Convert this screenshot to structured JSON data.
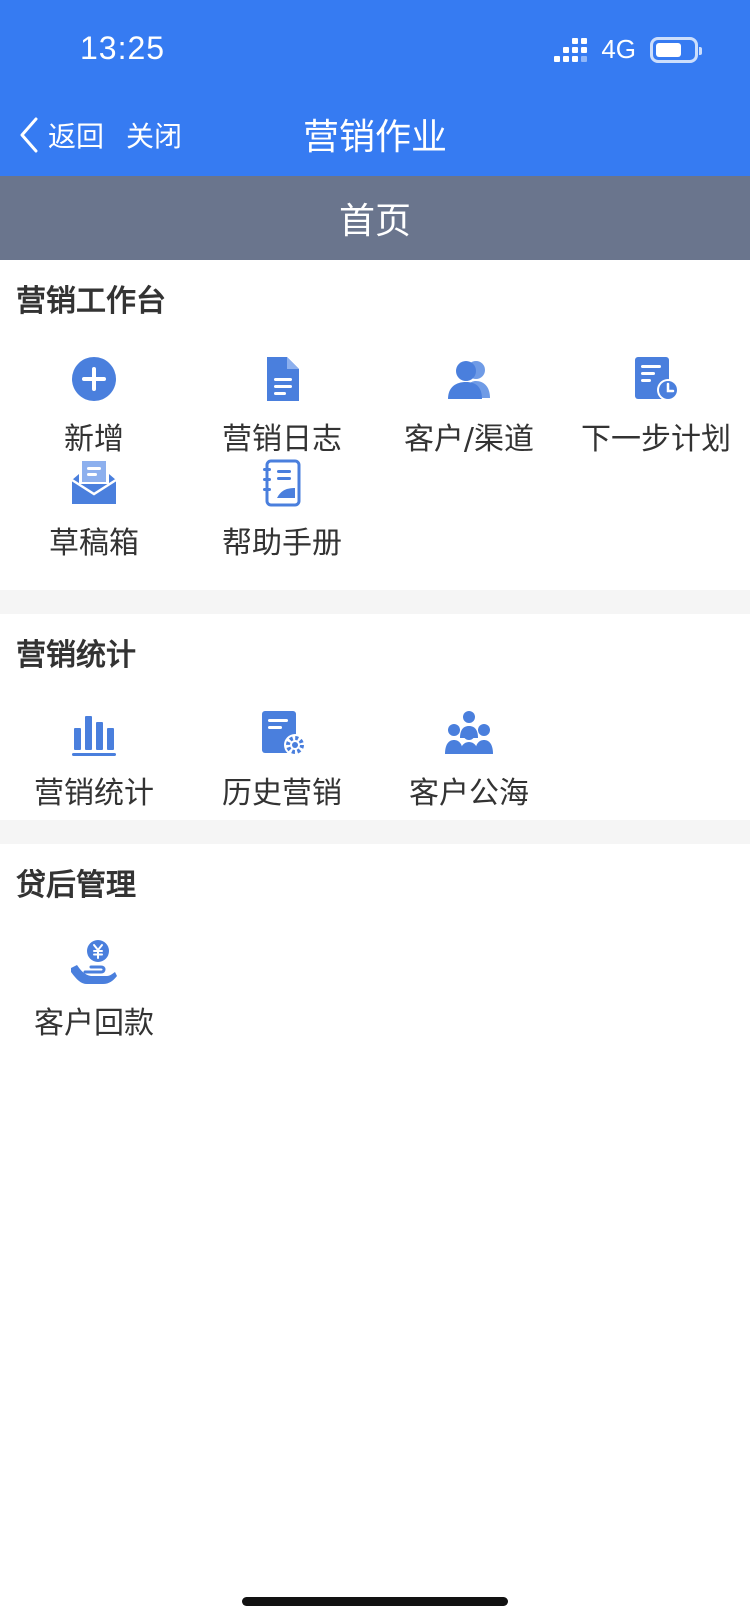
{
  "status_bar": {
    "time": "13:25",
    "network": "4G",
    "battery_level": 0.7
  },
  "nav": {
    "back_label": "返回",
    "close_label": "关闭",
    "title": "营销作业"
  },
  "page_tab": {
    "label": "首页"
  },
  "sections": {
    "workbench": {
      "title": "营销工作台",
      "items": [
        {
          "label": "新增",
          "icon": "plus-circle-icon"
        },
        {
          "label": "营销日志",
          "icon": "document-icon"
        },
        {
          "label": "客户/渠道",
          "icon": "users-icon"
        },
        {
          "label": "下一步计划",
          "icon": "plan-clock-icon"
        },
        {
          "label": "草稿箱",
          "icon": "draft-box-icon"
        },
        {
          "label": "帮助手册",
          "icon": "manual-notebook-icon"
        }
      ]
    },
    "stats": {
      "title": "营销统计",
      "items": [
        {
          "label": "营销统计",
          "icon": "bar-chart-icon"
        },
        {
          "label": "历史营销",
          "icon": "history-document-gear-icon"
        },
        {
          "label": "客户公海",
          "icon": "group-people-icon"
        }
      ]
    },
    "post_loan": {
      "title": "贷后管理",
      "items": [
        {
          "label": "客户回款",
          "icon": "hand-yen-coin-icon"
        }
      ]
    }
  },
  "colors": {
    "primary_blue": "#367BF2",
    "icon_blue": "#4A7FDD",
    "tab_bar": "#6A758D"
  }
}
